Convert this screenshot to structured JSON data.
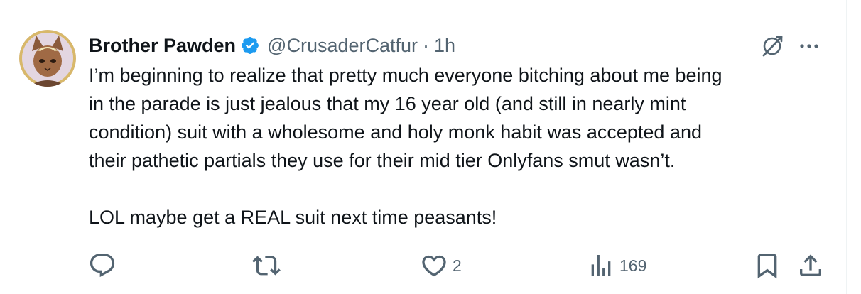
{
  "tweet": {
    "author": {
      "display_name": "Brother Pawden",
      "handle": "@CrusaderCatfur",
      "verified": true,
      "verified_color": "#1d9bf0"
    },
    "separator": "·",
    "time": "1h",
    "body": {
      "paragraph_1": "I’m beginning to realize that pretty much everyone bitching about me being\nin the parade is just jealous that my 16 year old (and still in nearly mint\ncondition) suit with a wholesome and holy monk habit was accepted and\ntheir pathetic partials they use for their mid tier Onlyfans smut wasn’t.",
      "paragraph_2": "LOL maybe get a REAL suit next time peasants!"
    },
    "actions": {
      "reply": {
        "icon": "reply-icon",
        "count": ""
      },
      "retweet": {
        "icon": "retweet-icon",
        "count": ""
      },
      "like": {
        "icon": "heart-icon",
        "count": "2"
      },
      "views": {
        "icon": "views-icon",
        "count": "169"
      },
      "bookmark": {
        "icon": "bookmark-icon"
      },
      "share": {
        "icon": "share-icon"
      }
    },
    "header_icons": [
      "grok-icon",
      "more-icon"
    ]
  },
  "colors": {
    "text_primary": "#0f1419",
    "text_secondary": "#536471",
    "accent": "#1d9bf0",
    "border": "#eff3f4"
  }
}
